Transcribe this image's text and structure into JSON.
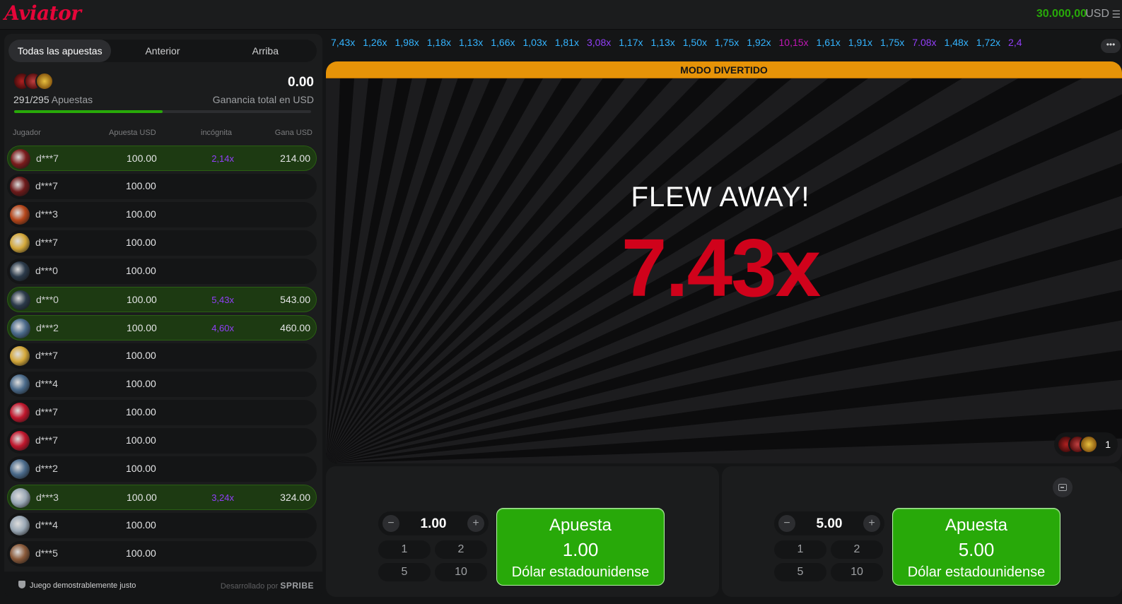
{
  "header": {
    "logo": "Aviator",
    "balance": "30.000,00",
    "currency": "USD",
    "menu_icon": "hamburger-icon"
  },
  "bets_panel": {
    "tabs": [
      "Todas las apuestas",
      "Anterior",
      "Arriba"
    ],
    "active_tab": 0,
    "bets_count": "291/295",
    "bets_label": "Apuestas",
    "total_win": "0.00",
    "total_win_label": "Ganancia total en USD",
    "progress": 0.5,
    "columns": [
      "Jugador",
      "Apuesta USD",
      "incógnita",
      "Gana USD"
    ],
    "rows": [
      {
        "player": "d***7",
        "bet": "100.00",
        "mult": "2,14x",
        "win": "214.00",
        "won": true,
        "avatar": "#7a1c1c"
      },
      {
        "player": "d***7",
        "bet": "100.00",
        "mult": "",
        "win": "",
        "won": false,
        "avatar": "#6d1a1a"
      },
      {
        "player": "d***3",
        "bet": "100.00",
        "mult": "",
        "win": "",
        "won": false,
        "avatar": "#b5461a"
      },
      {
        "player": "d***7",
        "bet": "100.00",
        "mult": "",
        "win": "",
        "won": false,
        "avatar": "#d4a83a"
      },
      {
        "player": "d***0",
        "bet": "100.00",
        "mult": "",
        "win": "",
        "won": false,
        "avatar": "#2b3a4a"
      },
      {
        "player": "d***0",
        "bet": "100.00",
        "mult": "5,43x",
        "win": "543.00",
        "won": true,
        "avatar": "#2b3a4a"
      },
      {
        "player": "d***2",
        "bet": "100.00",
        "mult": "4,60x",
        "win": "460.00",
        "won": true,
        "avatar": "#4a6a8a"
      },
      {
        "player": "d***7",
        "bet": "100.00",
        "mult": "",
        "win": "",
        "won": false,
        "avatar": "#d4a83a"
      },
      {
        "player": "d***4",
        "bet": "100.00",
        "mult": "",
        "win": "",
        "won": false,
        "avatar": "#4a6a8a"
      },
      {
        "player": "d***7",
        "bet": "100.00",
        "mult": "",
        "win": "",
        "won": false,
        "avatar": "#c0162c"
      },
      {
        "player": "d***7",
        "bet": "100.00",
        "mult": "",
        "win": "",
        "won": false,
        "avatar": "#c0162c"
      },
      {
        "player": "d***2",
        "bet": "100.00",
        "mult": "",
        "win": "",
        "won": false,
        "avatar": "#4a6a8a"
      },
      {
        "player": "d***3",
        "bet": "100.00",
        "mult": "3,24x",
        "win": "324.00",
        "won": true,
        "avatar": "#9aa8b5"
      },
      {
        "player": "d***4",
        "bet": "100.00",
        "mult": "",
        "win": "",
        "won": false,
        "avatar": "#9aa8b5"
      },
      {
        "player": "d***5",
        "bet": "100.00",
        "mult": "",
        "win": "",
        "won": false,
        "avatar": "#8a5a3a"
      }
    ],
    "footer_fair": "Juego demostrablemente justo",
    "footer_powered": "Desarrollado por",
    "footer_brand": "SPRIBE"
  },
  "history": [
    {
      "v": "7,43x",
      "c": "blue"
    },
    {
      "v": "1,26x",
      "c": "blue"
    },
    {
      "v": "1,98x",
      "c": "blue"
    },
    {
      "v": "1,18x",
      "c": "blue"
    },
    {
      "v": "1,13x",
      "c": "blue"
    },
    {
      "v": "1,66x",
      "c": "blue"
    },
    {
      "v": "1,03x",
      "c": "blue"
    },
    {
      "v": "1,81x",
      "c": "blue"
    },
    {
      "v": "3,08x",
      "c": "purple"
    },
    {
      "v": "1,17x",
      "c": "blue"
    },
    {
      "v": "1,13x",
      "c": "blue"
    },
    {
      "v": "1,50x",
      "c": "blue"
    },
    {
      "v": "1,75x",
      "c": "blue"
    },
    {
      "v": "1,92x",
      "c": "blue"
    },
    {
      "v": "10,15x",
      "c": "pink"
    },
    {
      "v": "1,61x",
      "c": "blue"
    },
    {
      "v": "1,91x",
      "c": "blue"
    },
    {
      "v": "1,75x",
      "c": "blue"
    },
    {
      "v": "7.08x",
      "c": "purple"
    },
    {
      "v": "1,48x",
      "c": "blue"
    },
    {
      "v": "1,72x",
      "c": "blue"
    },
    {
      "v": "2,4",
      "c": "purple"
    }
  ],
  "history_more": "•••",
  "game": {
    "mode_banner": "MODO DIVERTIDO",
    "flew_text": "FLEW AWAY!",
    "multiplier": "7.43x",
    "players_online": "1"
  },
  "bet_panels": [
    {
      "amount": "1.00",
      "quick": [
        "1",
        "2",
        "5",
        "10"
      ],
      "btn_title": "Apuesta",
      "btn_amount": "1.00",
      "btn_currency": "Dólar estadounidense"
    },
    {
      "amount": "5.00",
      "quick": [
        "1",
        "2",
        "5",
        "10"
      ],
      "btn_title": "Apuesta",
      "btn_amount": "5.00",
      "btn_currency": "Dólar estadounidense"
    }
  ],
  "colors": {
    "brand": "#e50539",
    "balance": "#28a909",
    "bet_button": "#28a909",
    "multiplier": "#d0021b",
    "history_blue": "#34b4ff",
    "history_purple": "#913ef8",
    "history_pink": "#c017b4",
    "fun_mode": "#e69308"
  }
}
